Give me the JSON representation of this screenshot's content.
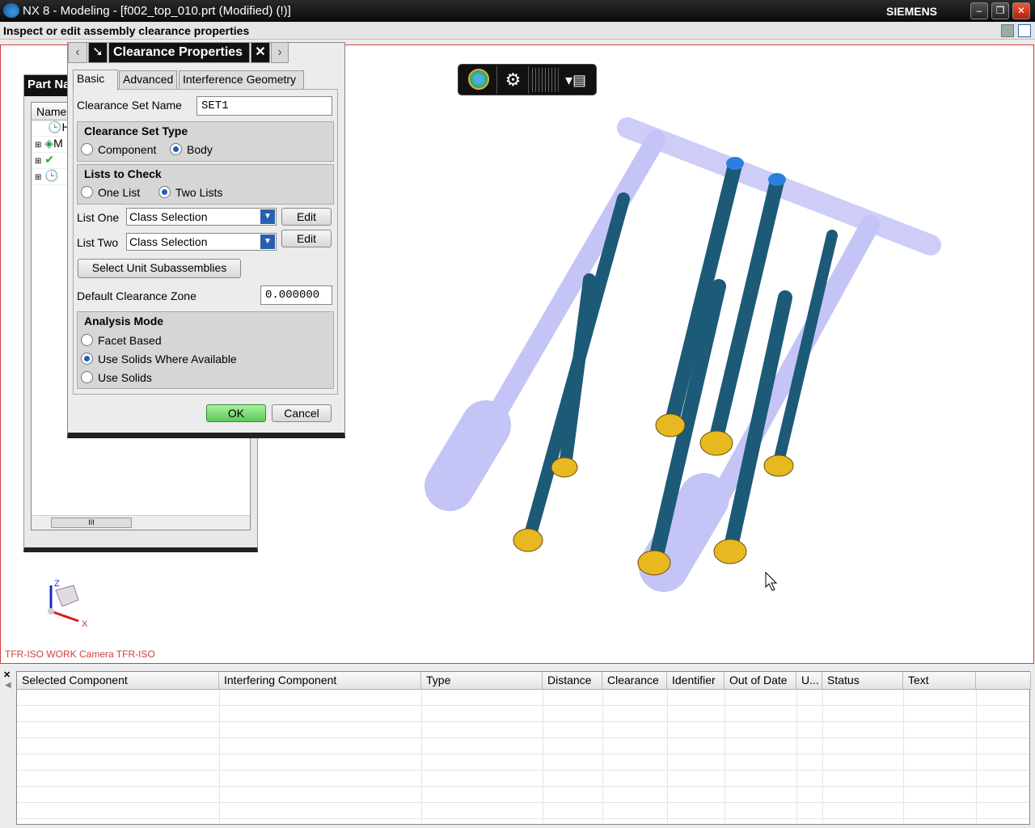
{
  "window": {
    "title": "NX 8 - Modeling - [f002_top_010.prt (Modified)     (!)]",
    "brand": "SIEMENS",
    "minimize": "–",
    "restore": "❐",
    "close": "✕"
  },
  "status": {
    "prompt": "Inspect or edit assembly clearance properties"
  },
  "part_navigator": {
    "title": "Part Na",
    "column": "Name",
    "items": [
      {
        "label": "H"
      },
      {
        "label": "M"
      },
      {
        "label": ""
      },
      {
        "label": ""
      }
    ],
    "scroll_label": "III"
  },
  "dialog": {
    "title": "Clearance Properties",
    "tabs": [
      "Basic",
      "Advanced",
      "Interference Geometry"
    ],
    "active_tab": "Basic",
    "set_name_label": "Clearance Set Name",
    "set_name_value": "SET1",
    "set_type": {
      "title": "Clearance Set Type",
      "options": [
        "Component",
        "Body"
      ],
      "selected": "Body"
    },
    "lists": {
      "title": "Lists to Check",
      "options": [
        "One List",
        "Two Lists"
      ],
      "selected": "Two Lists"
    },
    "list_one": {
      "label": "List One",
      "value": "Class Selection",
      "edit": "Edit"
    },
    "list_two": {
      "label": "List Two",
      "value": "Class Selection",
      "edit": "Edit"
    },
    "select_unit": "Select Unit Subassemblies",
    "zone_label": "Default Clearance Zone",
    "zone_value": "0.000000",
    "analysis": {
      "title": "Analysis Mode",
      "options": [
        "Facet Based",
        "Use Solids Where Available",
        "Use Solids"
      ],
      "selected": "Use Solids Where Available"
    },
    "ok": "OK",
    "cancel": "Cancel"
  },
  "viewport": {
    "camera_label": "TFR-ISO WORK Camera TFR-ISO",
    "axis_z": "Z",
    "axis_x": "X"
  },
  "results": {
    "columns": [
      "Selected Component",
      "Interfering Component",
      "Type",
      "Distance",
      "Clearance",
      "Identifier",
      "Out of Date",
      "U...",
      "Status",
      "Text"
    ],
    "rows": []
  },
  "colors": {
    "rod": "#1c5a78",
    "accent_ok": "#6cd46c",
    "ghost": "#a8a8f0"
  }
}
